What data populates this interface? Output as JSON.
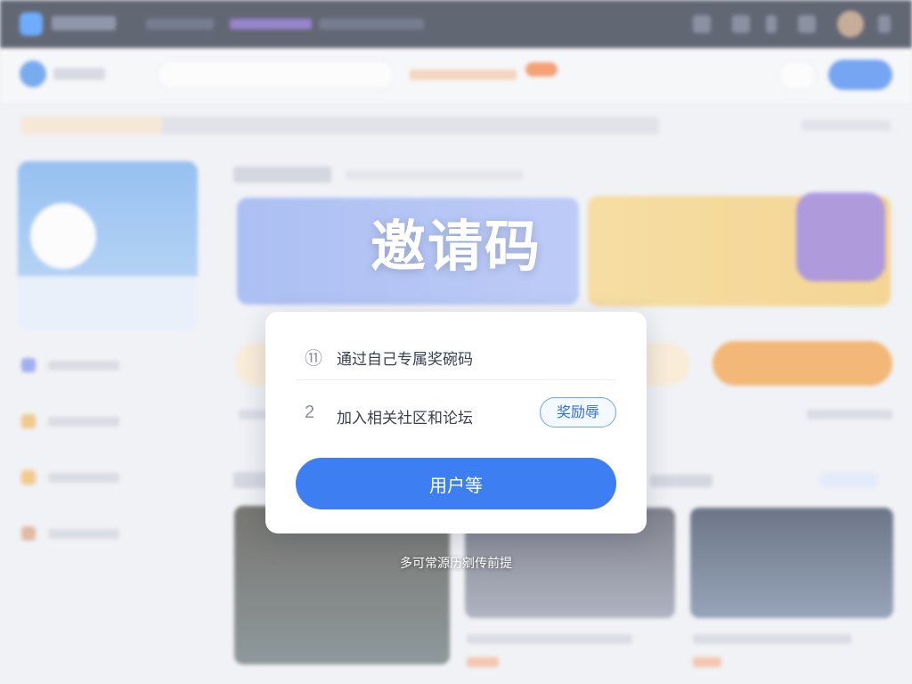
{
  "modal": {
    "title": "邀请码",
    "steps": [
      {
        "number": "⑪",
        "text": "通过自己专属奖碗码"
      },
      {
        "number": "2",
        "text": "加入相关社区和论坛",
        "button_label": "奖励辱"
      }
    ],
    "primary_button_label": "用户等"
  },
  "hint": {
    "text": "多可常源历剜传前提"
  },
  "colors": {
    "accent": "#3d7ef2",
    "topbar": "#1d2436",
    "orange": "#f29a3a"
  }
}
